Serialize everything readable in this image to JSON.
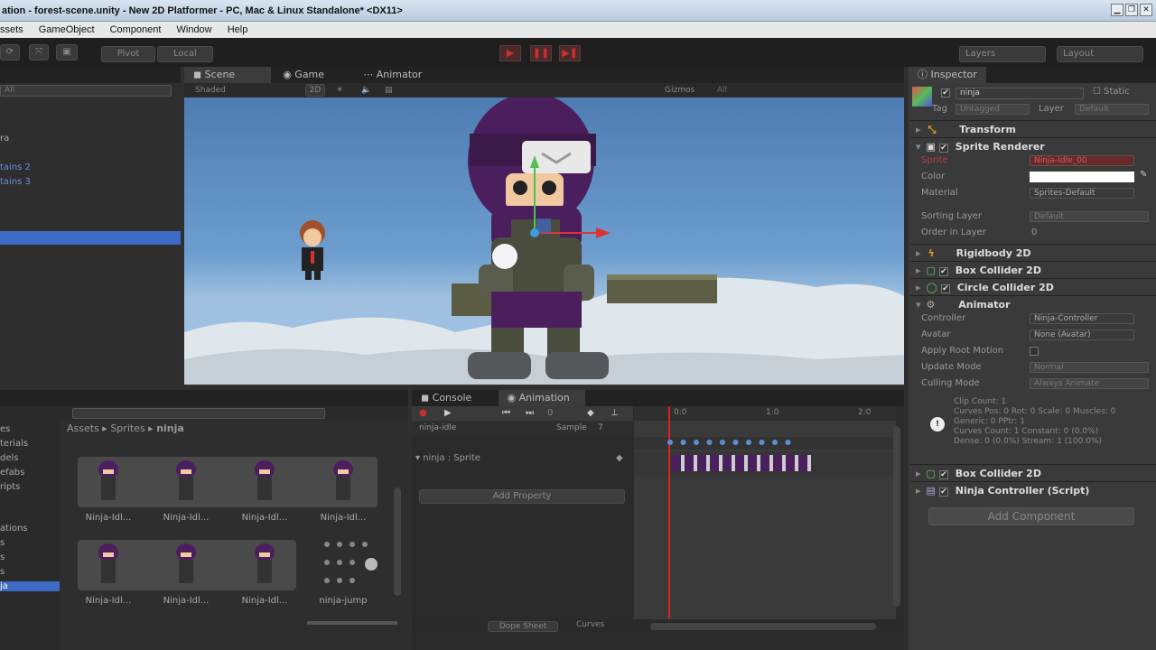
{
  "window": {
    "title": "ation - forest-scene.unity - New 2D Platformer - PC, Mac & Linux Standalone* <DX11>"
  },
  "menu": [
    "ssets",
    "GameObject",
    "Component",
    "Window",
    "Help"
  ],
  "toolbar": {
    "pivot": "Pivot",
    "local": "Local",
    "layers": "Layers",
    "layout": "Layout"
  },
  "hierarchy": {
    "items": [
      "ra",
      "tains 2",
      "tains 3"
    ],
    "search": "All"
  },
  "scene_tabs": {
    "scene": "Scene",
    "game": "Game",
    "animator": "Animator"
  },
  "scene_bar": {
    "shading": "Shaded",
    "mode2d": "2D",
    "gizmos": "Gizmos",
    "search": "All"
  },
  "inspector": {
    "tab": "Inspector",
    "object_name": "ninja",
    "static": "Static",
    "tag_label": "Tag",
    "tag_value": "Untagged",
    "layer_label": "Layer",
    "layer_value": "Default",
    "transform": "Transform",
    "sprite_renderer": "Sprite Renderer",
    "sprite_label": "Sprite",
    "sprite_value": "Ninja-Idle_00",
    "color_label": "Color",
    "material_label": "Material",
    "material_value": "Sprites-Default",
    "sorting_layer_label": "Sorting Layer",
    "sorting_layer_value": "Default",
    "order_label": "Order in Layer",
    "order_value": "0",
    "rigidbody": "Rigidbody 2D",
    "box_collider": "Box Collider 2D",
    "circle_collider": "Circle Collider 2D",
    "animator": "Animator",
    "controller_label": "Controller",
    "controller_value": "Ninja-Controller",
    "avatar_label": "Avatar",
    "avatar_value": "None (Avatar)",
    "root_motion_label": "Apply Root Motion",
    "update_mode_label": "Update Mode",
    "update_mode_value": "Normal",
    "culling_label": "Culling Mode",
    "culling_value": "Always Animate",
    "info": [
      "Clip Count: 1",
      "Curves Pos: 0 Rot: 0 Scale: 0 Muscles: 0",
      "Generic: 0 PPtr: 1",
      "Curves Count: 1 Constant: 0 (0.0%)",
      "Dense: 0 (0.0%) Stream: 1 (100.0%)"
    ],
    "box_collider_2": "Box Collider 2D",
    "script": "Ninja Controller (Script)",
    "add_component": "Add Component"
  },
  "project": {
    "tree": [
      "es",
      "terials",
      "dels",
      "efabs",
      "ripts",
      "ations",
      "s",
      "s",
      "s",
      "ja"
    ],
    "breadcrumb": [
      "Assets",
      "Sprites",
      "ninja"
    ],
    "assets": [
      "Ninja-Idl...",
      "Ninja-Idl...",
      "Ninja-Idl...",
      "Ninja-Idl...",
      "Ninja-Idl...",
      "Ninja-Idl...",
      "Ninja-Idl...",
      "ninja-jump"
    ]
  },
  "console_tab": "Console",
  "animation": {
    "tab": "Animation",
    "frame": "0",
    "clip": "ninja-idle",
    "sample_label": "Sample",
    "sample_value": "7",
    "property": "ninja : Sprite",
    "add_property": "Add Property",
    "ticks": [
      "0:0",
      "1:0",
      "2:0"
    ],
    "dopesheet": "Dope Sheet",
    "curves": "Curves"
  },
  "colors": {
    "accent": "#c83030",
    "selection": "#3d6ac4"
  }
}
